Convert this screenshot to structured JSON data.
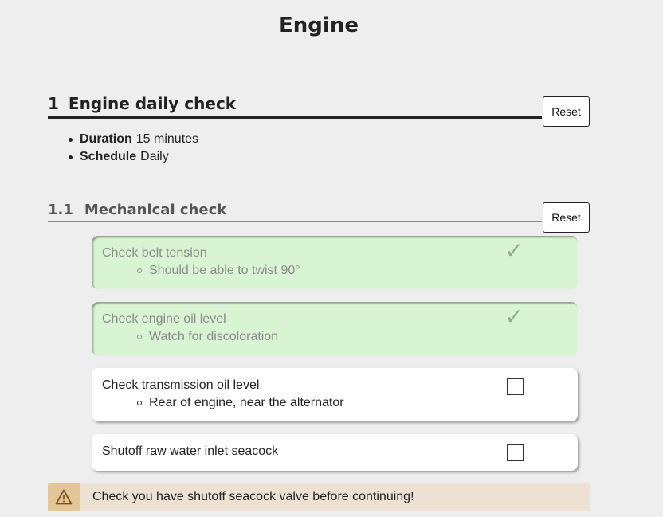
{
  "page": {
    "title": "Engine"
  },
  "section1": {
    "number": "1",
    "title": "Engine daily check",
    "reset_label": "Reset",
    "meta": [
      {
        "label": "Duration",
        "value": "15 minutes"
      },
      {
        "label": "Schedule",
        "value": "Daily"
      }
    ]
  },
  "section11": {
    "number": "1.1",
    "title": "Mechanical check",
    "reset_label": "Reset",
    "items": [
      {
        "title": "Check belt tension",
        "sub": "Should be able to twist 90°",
        "checked": true
      },
      {
        "title": "Check engine oil level",
        "sub": "Watch for discoloration",
        "checked": true
      },
      {
        "title": "Check transmission oil level",
        "sub": "Rear of engine, near the alternator",
        "checked": false
      },
      {
        "title": "Shutoff raw water inlet seacock",
        "checked": false
      }
    ]
  },
  "warning": {
    "icon": "warning-triangle-icon",
    "text": "Check you have shutoff seacock valve before continuing!"
  },
  "icons": {
    "checked": "checkmark-icon"
  },
  "colors": {
    "done_bg": "#d9f4d3",
    "warning_bg": "#ece1d3",
    "warning_icon_bg": "#e3c597",
    "page_bg": "#eeeeee"
  }
}
